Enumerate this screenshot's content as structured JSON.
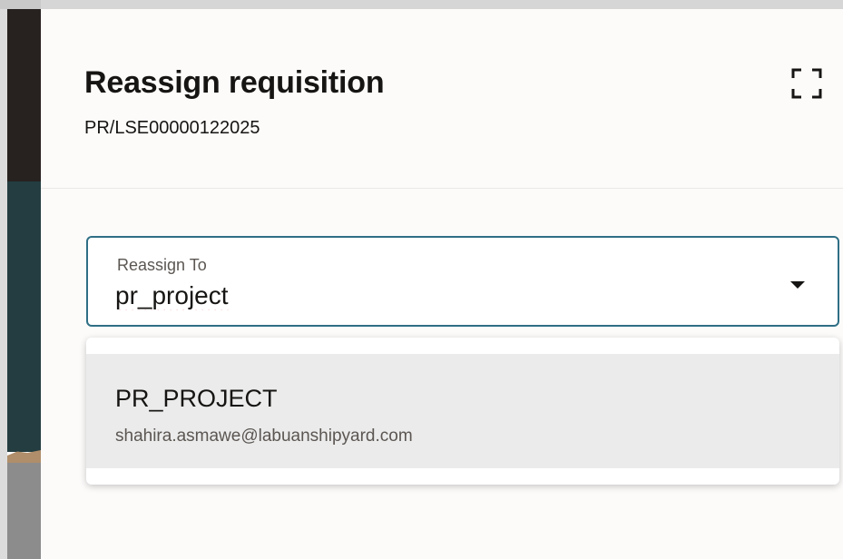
{
  "drawer": {
    "title": "Reassign requisition",
    "subtitle": "PR/LSE00000122025",
    "expand_icon": "expand-icon"
  },
  "reassign_field": {
    "label": "Reassign To",
    "value": "pr_project",
    "dropdown_icon": "caret-down-icon"
  },
  "suggestions": [
    {
      "name": "PR_PROJECT",
      "email": "shahira.asmawe@labuanshipyard.com"
    }
  ],
  "colors": {
    "focus_border": "#2f6f85",
    "highlight": "#ebebeb",
    "spellcheck": "#e0282e"
  }
}
